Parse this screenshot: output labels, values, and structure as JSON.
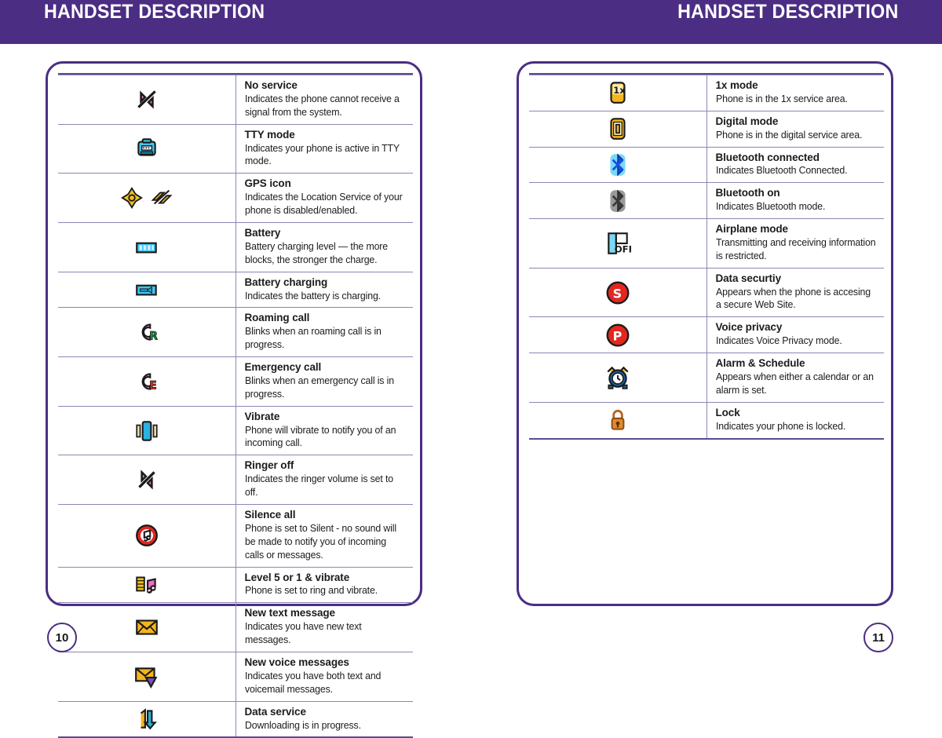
{
  "header": {
    "left_title": "HANDSET DESCRIPTION",
    "right_title": "HANDSET DESCRIPTION",
    "bar_color": "#4B2D83"
  },
  "theme": {
    "accent": "#4B2D83",
    "rule": "#8D86B4",
    "text": "#1B1B1B"
  },
  "left_page": {
    "page_number": "10",
    "rows": [
      {
        "icons": [
          "no-service-icon"
        ],
        "title": "No service",
        "desc": "Indicates the phone cannot receive a signal from the system."
      },
      {
        "icons": [
          "tty-mode-icon"
        ],
        "title": "TTY mode",
        "desc": "Indicates your phone is active in TTY mode."
      },
      {
        "icons": [
          "gps-disabled-icon",
          "gps-enabled-icon"
        ],
        "title": "GPS icon",
        "desc": "Indicates the Location Service of your phone is disabled/enabled."
      },
      {
        "icons": [
          "battery-icon"
        ],
        "title": "Battery",
        "desc": "Battery charging level — the more blocks, the stronger the charge."
      },
      {
        "icons": [
          "battery-charging-icon"
        ],
        "title": "Battery charging",
        "desc": "Indicates the battery is charging."
      },
      {
        "icons": [
          "roaming-call-icon"
        ],
        "title": "Roaming call",
        "desc": "Blinks when an roaming call is in progress."
      },
      {
        "icons": [
          "emergency-call-icon"
        ],
        "title": "Emergency call",
        "desc": "Blinks when an emergency call is in progress."
      },
      {
        "icons": [
          "vibrate-icon"
        ],
        "title": "Vibrate",
        "desc": "Phone will vibrate to notify you of an incoming call."
      },
      {
        "icons": [
          "ringer-off-icon"
        ],
        "title": "Ringer off",
        "desc": "Indicates the ringer volume is set to off."
      },
      {
        "icons": [
          "silence-all-icon"
        ],
        "title": "Silence all",
        "desc": "Phone is set to Silent - no sound will be made to notify you of incoming calls or messages."
      },
      {
        "icons": [
          "ring-and-vibrate-icon"
        ],
        "title": "Level 5 or 1 & vibrate",
        "desc": "Phone is set to ring and vibrate."
      },
      {
        "icons": [
          "new-text-message-icon"
        ],
        "title": "New text message",
        "desc": "Indicates you have new text messages."
      },
      {
        "icons": [
          "new-voice-message-icon"
        ],
        "title": "New voice messages",
        "desc": "Indicates you have both text and voicemail messages."
      },
      {
        "icons": [
          "data-service-icon"
        ],
        "title": "Data service",
        "desc": "Downloading is in progress."
      }
    ]
  },
  "right_page": {
    "page_number": "11",
    "rows": [
      {
        "icons": [
          "one-x-mode-icon"
        ],
        "title": "1x mode",
        "desc": "Phone is in the 1x service area."
      },
      {
        "icons": [
          "digital-mode-icon"
        ],
        "title": "Digital mode",
        "desc": "Phone is in the digital service area."
      },
      {
        "icons": [
          "bluetooth-connected-icon"
        ],
        "title": "Bluetooth connected",
        "desc": "Indicates Bluetooth Connected."
      },
      {
        "icons": [
          "bluetooth-on-icon"
        ],
        "title": "Bluetooth on",
        "desc": "Indicates Bluetooth mode."
      },
      {
        "icons": [
          "airplane-mode-icon"
        ],
        "title": "Airplane mode",
        "desc": "Transmitting and receiving information is restricted."
      },
      {
        "icons": [
          "data-security-icon"
        ],
        "title": "Data securtiy",
        "desc": "Appears when the phone is accesing a secure Web Site."
      },
      {
        "icons": [
          "voice-privacy-icon"
        ],
        "title": "Voice privacy",
        "desc": "Indicates Voice Privacy mode."
      },
      {
        "icons": [
          "alarm-schedule-icon"
        ],
        "title": "Alarm & Schedule",
        "desc": "Appears when either a calendar or an alarm is set."
      },
      {
        "icons": [
          "lock-icon"
        ],
        "title": "Lock",
        "desc": "Indicates your phone is locked."
      }
    ]
  }
}
